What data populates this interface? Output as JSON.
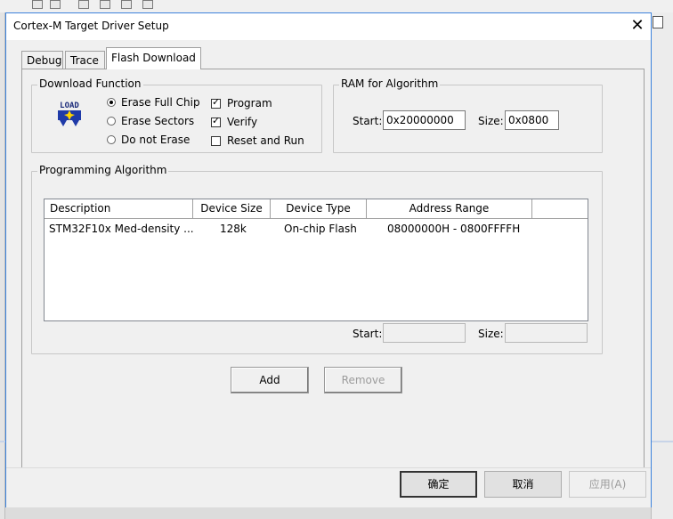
{
  "window": {
    "title": "Cortex-M Target Driver Setup"
  },
  "tabs": [
    {
      "label": "Debug"
    },
    {
      "label": "Trace"
    },
    {
      "label": "Flash Download"
    }
  ],
  "download_function": {
    "title": "Download Function",
    "load_icon_text": "LOAD",
    "options": [
      {
        "label": "Erase Full Chip",
        "selected": true
      },
      {
        "label": "Erase Sectors",
        "selected": false
      },
      {
        "label": "Do not Erase",
        "selected": false
      }
    ],
    "checkboxes": [
      {
        "label": "Program",
        "checked": true
      },
      {
        "label": "Verify",
        "checked": true
      },
      {
        "label": "Reset and Run",
        "checked": false
      }
    ],
    "check_mark": "✓"
  },
  "ram_algorithm": {
    "title": "RAM for Algorithm",
    "start_label": "Start:",
    "start_value": "0x20000000",
    "size_label": "Size:",
    "size_value": "0x0800"
  },
  "programming_algorithm": {
    "title": "Programming Algorithm",
    "columns": [
      "Description",
      "Device Size",
      "Device Type",
      "Address Range"
    ],
    "rows": [
      {
        "description": "STM32F10x Med-density ...",
        "size": "128k",
        "type": "On-chip Flash",
        "range": "08000000H - 0800FFFFH"
      }
    ],
    "start_label": "Start:",
    "start_value": "",
    "size_label": "Size:",
    "size_value": ""
  },
  "buttons": {
    "add": "Add",
    "remove": "Remove",
    "ok": "确定",
    "cancel": "取消",
    "apply": "应用(A)"
  },
  "close_glyph": "✕"
}
